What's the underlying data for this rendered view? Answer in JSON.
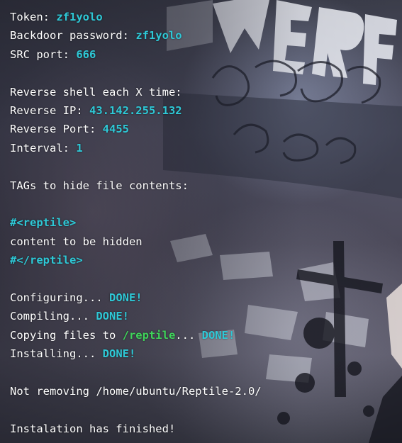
{
  "terminal": {
    "token_label": "Token: ",
    "token_value": "zf1yolo",
    "backdoor_label": "Backdoor password: ",
    "backdoor_value": "zf1yolo",
    "src_port_label": "SRC port: ",
    "src_port_value": "666",
    "reverse_shell_heading": "Reverse shell each X time:",
    "reverse_ip_label": "Reverse IP: ",
    "reverse_ip_value": "43.142.255.132",
    "reverse_port_label": "Reverse Port: ",
    "reverse_port_value": "4455",
    "interval_label": "Interval: ",
    "interval_value": "1",
    "tags_heading": "TAGs to hide file contents:",
    "tag_open": "#<reptile>",
    "tag_content": "content to be hidden",
    "tag_close": "#</reptile>",
    "configuring_label": "Configuring... ",
    "compiling_label": "Compiling... ",
    "copying_label": "Copying files to ",
    "copying_path": "/reptile",
    "copying_suffix": "... ",
    "installing_label": "Installing... ",
    "done_label": "DONE!",
    "not_removing": "Not removing /home/ubuntu/Reptile-2.0/",
    "finished": "Instalation has finished!"
  },
  "colors": {
    "foreground": "#ffffff",
    "highlight_cyan": "#2ec8d6",
    "highlight_green": "#3fd35a"
  }
}
